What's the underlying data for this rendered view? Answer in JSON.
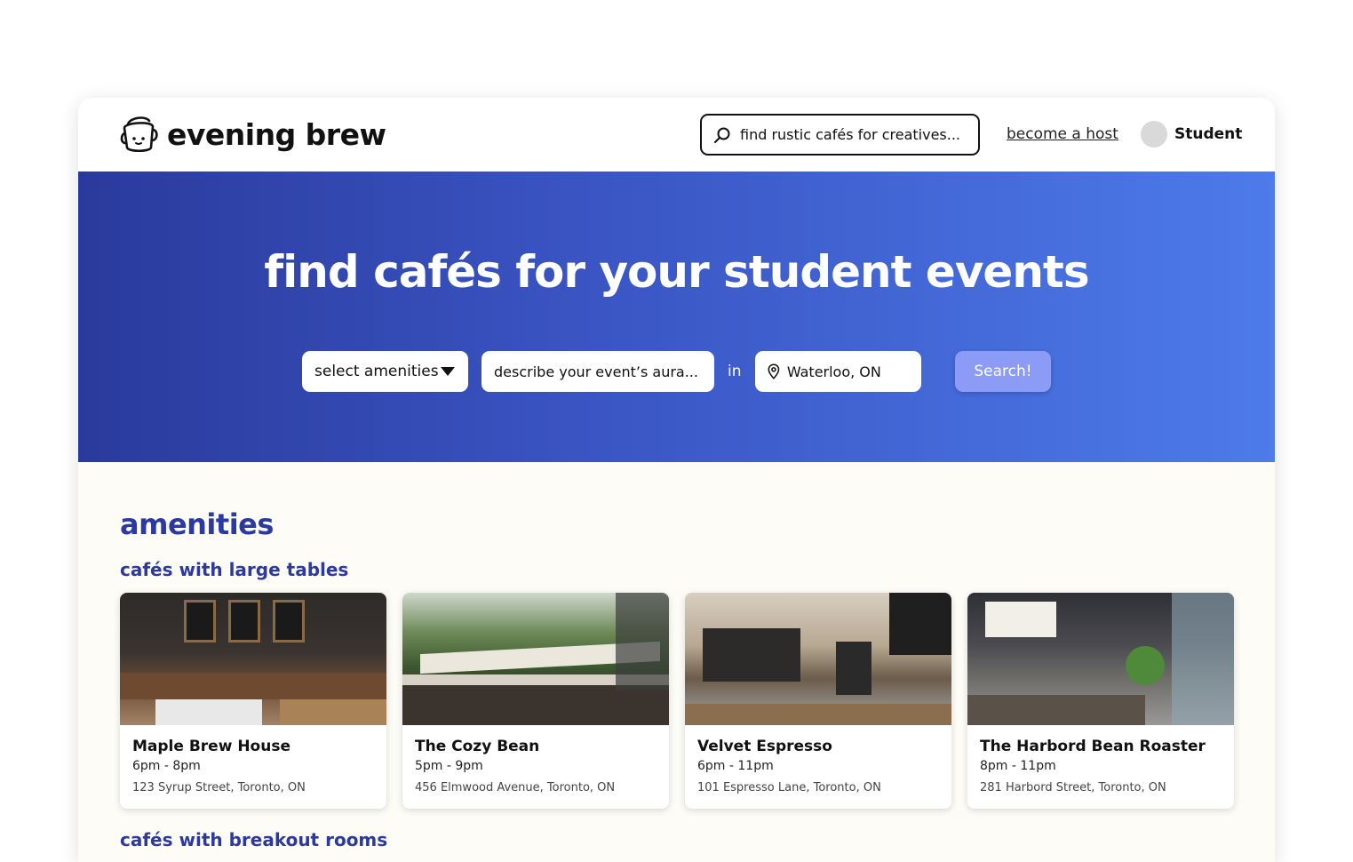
{
  "brand": {
    "name": "evening brew"
  },
  "header": {
    "search_placeholder": "find rustic cafés for creatives...",
    "host_link": "become a host",
    "user_label": "Student"
  },
  "hero": {
    "title": "find cafés for your student events",
    "amenities_select": "select amenities",
    "aura_placeholder": "describe your event’s aura...",
    "in_label": "in",
    "location_value": "Waterloo, ON",
    "search_button": "Search!"
  },
  "main": {
    "section_title": "amenities",
    "groups": [
      {
        "title": "cafés with large tables",
        "cafes": [
          {
            "name": "Maple Brew House",
            "hours": "6pm - 8pm",
            "address": "123 Syrup Street, Toronto, ON"
          },
          {
            "name": "The Cozy Bean",
            "hours": "5pm - 9pm",
            "address": "456 Elmwood Avenue, Toronto, ON"
          },
          {
            "name": "Velvet Espresso",
            "hours": "6pm - 11pm",
            "address": "101 Espresso Lane, Toronto, ON"
          },
          {
            "name": "The Harbord Bean Roaster",
            "hours": "8pm - 11pm",
            "address": "281 Harbord Street, Toronto, ON"
          }
        ]
      },
      {
        "title": "cafés with breakout rooms"
      }
    ]
  },
  "colors": {
    "accent": "#2b3aa0",
    "hero_start": "#2a3a9c",
    "hero_end": "#4d7bea",
    "button": "#8c9bf6"
  },
  "icons": {
    "logo": "coffee-cup-icon",
    "search": "search-icon",
    "dropdown": "caret-down-icon",
    "location": "map-pin-icon"
  }
}
